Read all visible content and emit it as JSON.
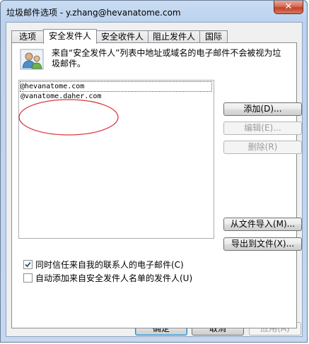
{
  "window": {
    "title": "垃圾邮件选项 - y.zhang@hevanatome.com",
    "close_glyph": "✕"
  },
  "tabs": [
    {
      "label": "选项"
    },
    {
      "label": "安全发件人"
    },
    {
      "label": "安全收件人"
    },
    {
      "label": "阻止发件人"
    },
    {
      "label": "国际"
    }
  ],
  "description": "来自“安全发件人”列表中地址或域名的电子邮件不会被视为垃圾邮件。",
  "senders": [
    "@hevanatome.com",
    "@vanatome.daher.com"
  ],
  "side_buttons": {
    "add": "添加(D)...",
    "edit": "编辑(E)...",
    "remove": "删除(R)",
    "import": "从文件导入(M)...",
    "export": "导出到文件(X)..."
  },
  "checkboxes": [
    {
      "label": "同时信任来自我的联系人的电子邮件(C)",
      "checked": true
    },
    {
      "label": "自动添加来自安全发件人名单的发件人(U)",
      "checked": false
    }
  ],
  "footer_buttons": {
    "ok": "确定",
    "cancel": "取消",
    "apply": "应用(A)"
  },
  "colors": {
    "annotation_ellipse": "#d9363e",
    "title_bar": "#bcd2ee"
  }
}
